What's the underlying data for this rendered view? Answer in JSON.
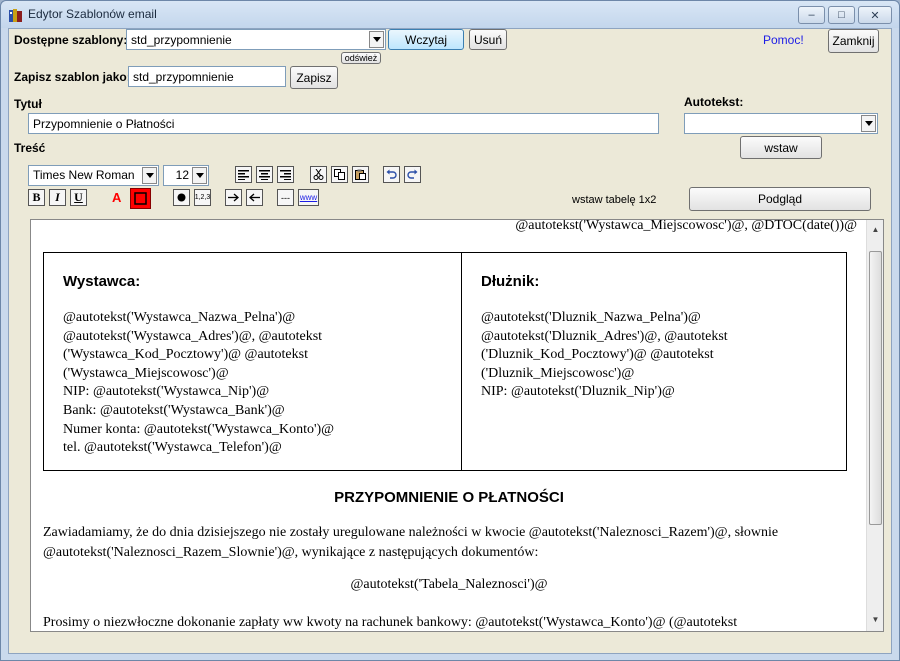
{
  "window": {
    "title": "Edytor Szablonów email",
    "controls": {
      "minimize": "‒",
      "maximize": "□",
      "close": "✕"
    }
  },
  "templates": {
    "label": "Dostępne szablony:",
    "selected": "std_przypomnienie",
    "load_button": "Wczytaj",
    "delete_button": "Usuń",
    "refresh_button": "odśwież"
  },
  "help_link": "Pomoc!",
  "close_button": "Zamknij",
  "save": {
    "label": "Zapisz szablon jako:",
    "value": "std_przypomnienie",
    "button": "Zapisz"
  },
  "title_field": {
    "label": "Tytuł",
    "value": "Przypomnienie o Płatności"
  },
  "autotext": {
    "label": "Autotekst:",
    "selected": "",
    "insert_button": "wstaw"
  },
  "content_label": "Treść",
  "toolbar": {
    "font_family": "Times New Roman",
    "font_size": "12",
    "bold": "B",
    "italic": "I",
    "underline": "U",
    "font_color": "A",
    "numbered_list": "1,2,3",
    "hr": "---",
    "link": "www",
    "insert_table": "wstaw tabelę 1x2",
    "preview_button": "Podgląd"
  },
  "colors": {
    "accent": "#ff0000",
    "link": "#1c1ce6"
  },
  "document": {
    "date_line": "@autotekst('Wystawca_Miejscowosc')@, @DTOC(date())@",
    "issuer": {
      "heading": "Wystawca:",
      "lines": [
        "@autotekst('Wystawca_Nazwa_Pelna')@",
        "@autotekst('Wystawca_Adres')@, @autotekst",
        "('Wystawca_Kod_Pocztowy')@ @autotekst",
        "('Wystawca_Miejscowosc')@",
        "NIP: @autotekst('Wystawca_Nip')@",
        "Bank: @autotekst('Wystawca_Bank')@",
        "Numer konta: @autotekst('Wystawca_Konto')@",
        "tel. @autotekst('Wystawca_Telefon')@"
      ]
    },
    "debtor": {
      "heading": "Dłużnik:",
      "lines": [
        "@autotekst('Dluznik_Nazwa_Pelna')@",
        "@autotekst('Dluznik_Adres')@, @autotekst",
        "('Dluznik_Kod_Pocztowy')@ @autotekst",
        "('Dluznik_Miejscowosc')@",
        "NIP: @autotekst('Dluznik_Nip')@"
      ]
    },
    "heading": "PRZYPOMNIENIE O PŁATNOŚCI",
    "paragraph1_line1": "Zawiadamiamy, że do dnia dzisiejszego nie zostały uregulowane należności w kwocie @autotekst('Naleznosci_Razem')@, słownie",
    "paragraph1_line2": "@autotekst('Naleznosci_Razem_Slownie')@, wynikające z następujących dokumentów:",
    "table_placeholder": "@autotekst('Tabela_Naleznosci')@",
    "paragraph2_line1": "Prosimy o niezwłoczne dokonanie zapłaty ww kwoty na rachunek bankowy: @autotekst('Wystawca_Konto')@ (@autotekst"
  }
}
